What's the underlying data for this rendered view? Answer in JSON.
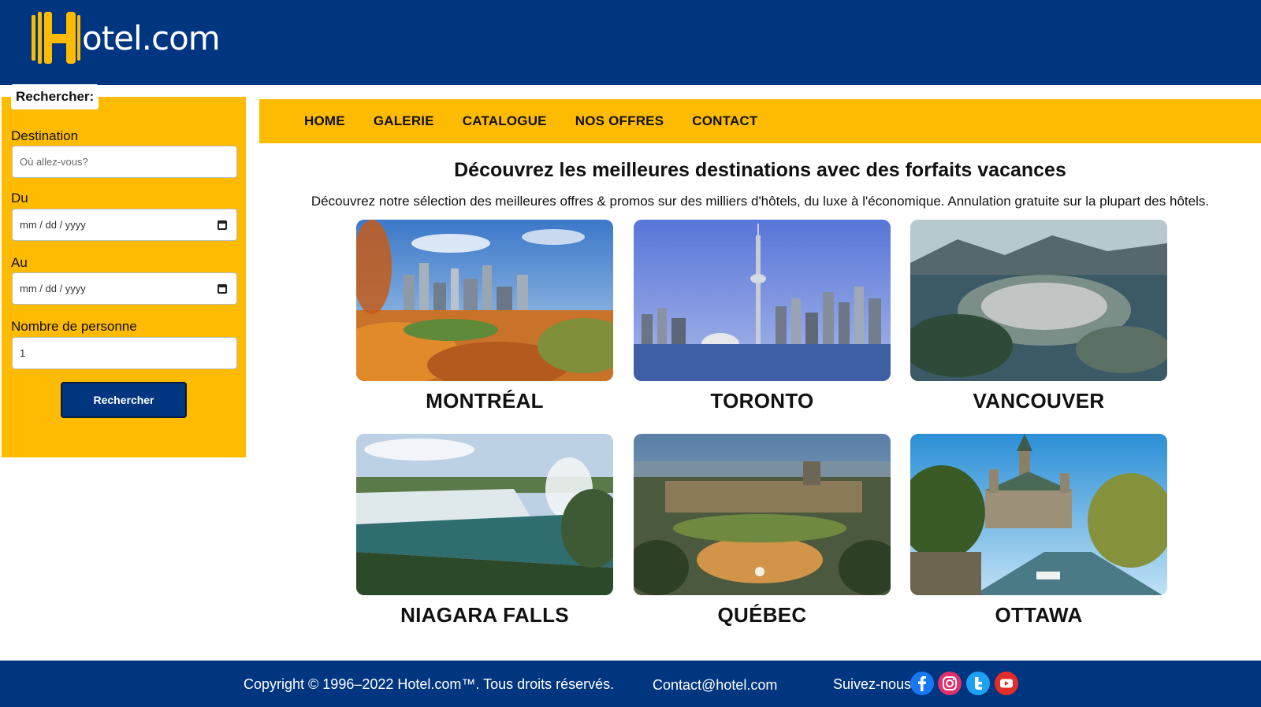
{
  "brand": {
    "logo_text": "otel.com",
    "logo_letter": "H"
  },
  "sidebar": {
    "tab_label": "Rechercher:",
    "destination_label": "Destination",
    "destination_placeholder": "Où allez-vous?",
    "from_label": "Du",
    "from_value": "mm / dd / yyyy",
    "to_label": "Au",
    "to_value": "mm / dd / yyyy",
    "people_label": "Nombre de personne",
    "people_value": "1",
    "search_button": "Rechercher"
  },
  "nav": [
    "HOME",
    "GALERIE",
    "CATALOGUE",
    "NOS OFFRES",
    "CONTACT"
  ],
  "main": {
    "headline": "Découvrez les meilleures destinations avec des forfaits vacances",
    "subline": "Découvrez notre sélection des meilleures offres & promos sur des milliers d'hôtels, du luxe à l'économique. Annulation gratuite sur la plupart des hôtels."
  },
  "destinations": [
    "MONTRÉAL",
    "TORONTO",
    "VANCOUVER",
    "NIAGARA FALLS",
    "QUÉBEC",
    "OTTAWA"
  ],
  "footer": {
    "copyright": "Copyright © 1996–2022 Hotel.com™. Tous droits réservés.",
    "contact": "Contact@hotel.com",
    "follow": "Suivez-nous"
  },
  "colors": {
    "brand_blue": "#003580",
    "brand_yellow": "#febb02"
  },
  "icons": [
    "facebook-icon",
    "instagram-icon",
    "twitter-icon",
    "youtube-icon"
  ]
}
